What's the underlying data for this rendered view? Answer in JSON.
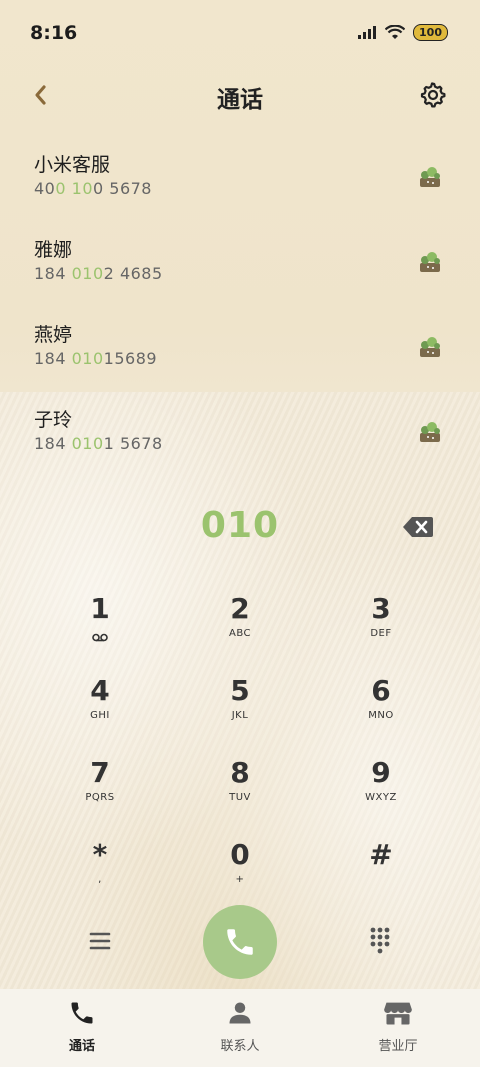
{
  "status_bar": {
    "time": "8:16",
    "battery": "100"
  },
  "header": {
    "title": "通话"
  },
  "contacts": [
    {
      "name": "小米客服",
      "number_parts": [
        "40",
        "0",
        " ",
        "10",
        "0 5678"
      ]
    },
    {
      "name": "雅娜",
      "number_parts": [
        "184 ",
        "010",
        "2 4685"
      ]
    },
    {
      "name": "燕婷",
      "number_parts": [
        "184 ",
        "010",
        "15689"
      ]
    },
    {
      "name": "子玲",
      "number_parts": [
        "184 ",
        "010",
        "1 5678"
      ]
    }
  ],
  "dialed_number": "010",
  "keypad": [
    {
      "digit": "1",
      "letters": ""
    },
    {
      "digit": "2",
      "letters": "ABC"
    },
    {
      "digit": "3",
      "letters": "DEF"
    },
    {
      "digit": "4",
      "letters": "GHI"
    },
    {
      "digit": "5",
      "letters": "JKL"
    },
    {
      "digit": "6",
      "letters": "MNO"
    },
    {
      "digit": "7",
      "letters": "PQRS"
    },
    {
      "digit": "8",
      "letters": "TUV"
    },
    {
      "digit": "9",
      "letters": "WXYZ"
    },
    {
      "digit": "*",
      "letters": ","
    },
    {
      "digit": "0",
      "letters": "+"
    },
    {
      "digit": "#",
      "letters": ""
    }
  ],
  "bottom_nav": [
    {
      "label": "通话",
      "icon": "phone-icon",
      "active": true
    },
    {
      "label": "联系人",
      "icon": "person-icon",
      "active": false
    },
    {
      "label": "营业厅",
      "icon": "store-icon",
      "active": false
    }
  ],
  "colors": {
    "accent": "#9bc36e",
    "call_button": "#a8c98a",
    "back_arrow": "#8a6a3a"
  }
}
